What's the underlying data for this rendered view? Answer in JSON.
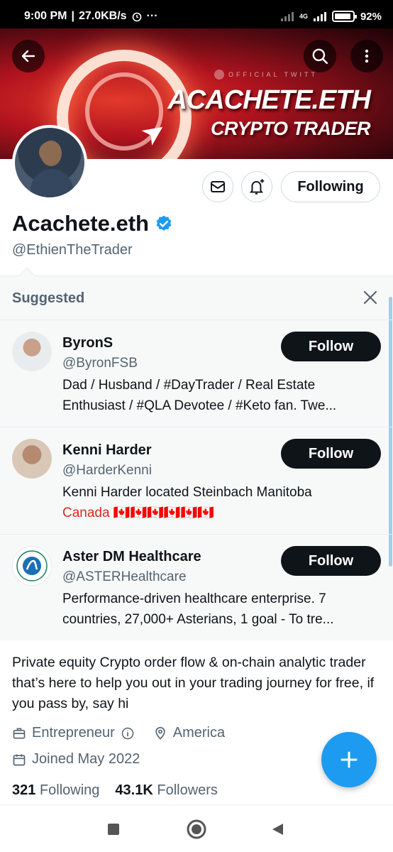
{
  "status_bar": {
    "time": "9:00 PM",
    "speed": "27.0KB/s",
    "network": "4G",
    "battery": "92%"
  },
  "banner": {
    "official": "OFFICIAL TWITT",
    "title": "ACACHETE.ETH",
    "subtitle": "CRYPTO TRADER"
  },
  "profile": {
    "display_name": "Acachete.eth",
    "handle": "@EthienTheTrader",
    "following_label": "Following",
    "bio": "Private equity Crypto order flow & on-chain analytic trader that’s here to help you out in your trading journey for free, if you pass by, say hi",
    "category": "Entrepreneur",
    "location": "America",
    "joined": "Joined May 2022",
    "following_count": "321",
    "following_text": "Following",
    "followers_count": "43.1K",
    "followers_text": "Followers"
  },
  "suggested": {
    "title": "Suggested",
    "follow_label": "Follow",
    "accounts": [
      {
        "name": "ByronS",
        "handle": "@ByronFSB",
        "bio_line1": "Dad / Husband / #DayTrader / Real Estate",
        "bio_line2": "Enthusiast / #QLA Devotee / #Keto fan. Twe..."
      },
      {
        "name": "Kenni Harder",
        "handle": "@HarderKenni",
        "bio_line1": "Kenni  Harder located Steinbach Manitoba",
        "bio_line2": "Canada 🇨🇦🇨🇦🇨🇦🇨🇦🇨🇦🇨🇦"
      },
      {
        "name": "Aster DM Healthcare",
        "handle": "@ASTERHealthcare",
        "bio_line1": "Performance-driven healthcare enterprise.  7",
        "bio_line2": "countries, 27,000+ Asterians, 1 goal -  To tre..."
      }
    ]
  },
  "colors": {
    "accent": "#1d9bf0",
    "verified": "#1d9bf0",
    "text_secondary": "#536471",
    "button_dark": "#0f1419"
  }
}
